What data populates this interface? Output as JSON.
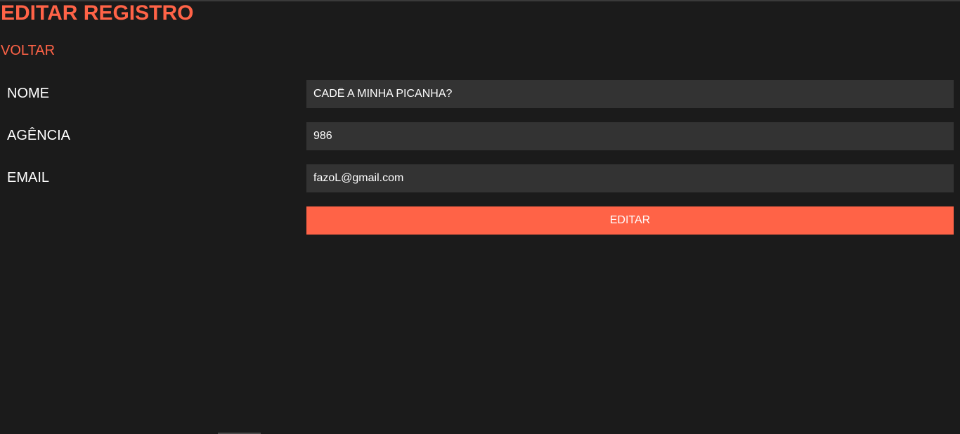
{
  "page": {
    "title": "EDITAR REGISTRO",
    "back_link": "VOLTAR"
  },
  "form": {
    "fields": [
      {
        "label": "NOME",
        "value": "CADÊ A MINHA PICANHA?"
      },
      {
        "label": "AGÊNCIA",
        "value": "986"
      },
      {
        "label": "EMAIL",
        "value": "fazoL@gmail.com"
      }
    ],
    "submit_label": "EDITAR"
  },
  "colors": {
    "background": "#1b1b1b",
    "accent": "#ff6347",
    "input_background": "#333333",
    "text": "#ffffff"
  }
}
